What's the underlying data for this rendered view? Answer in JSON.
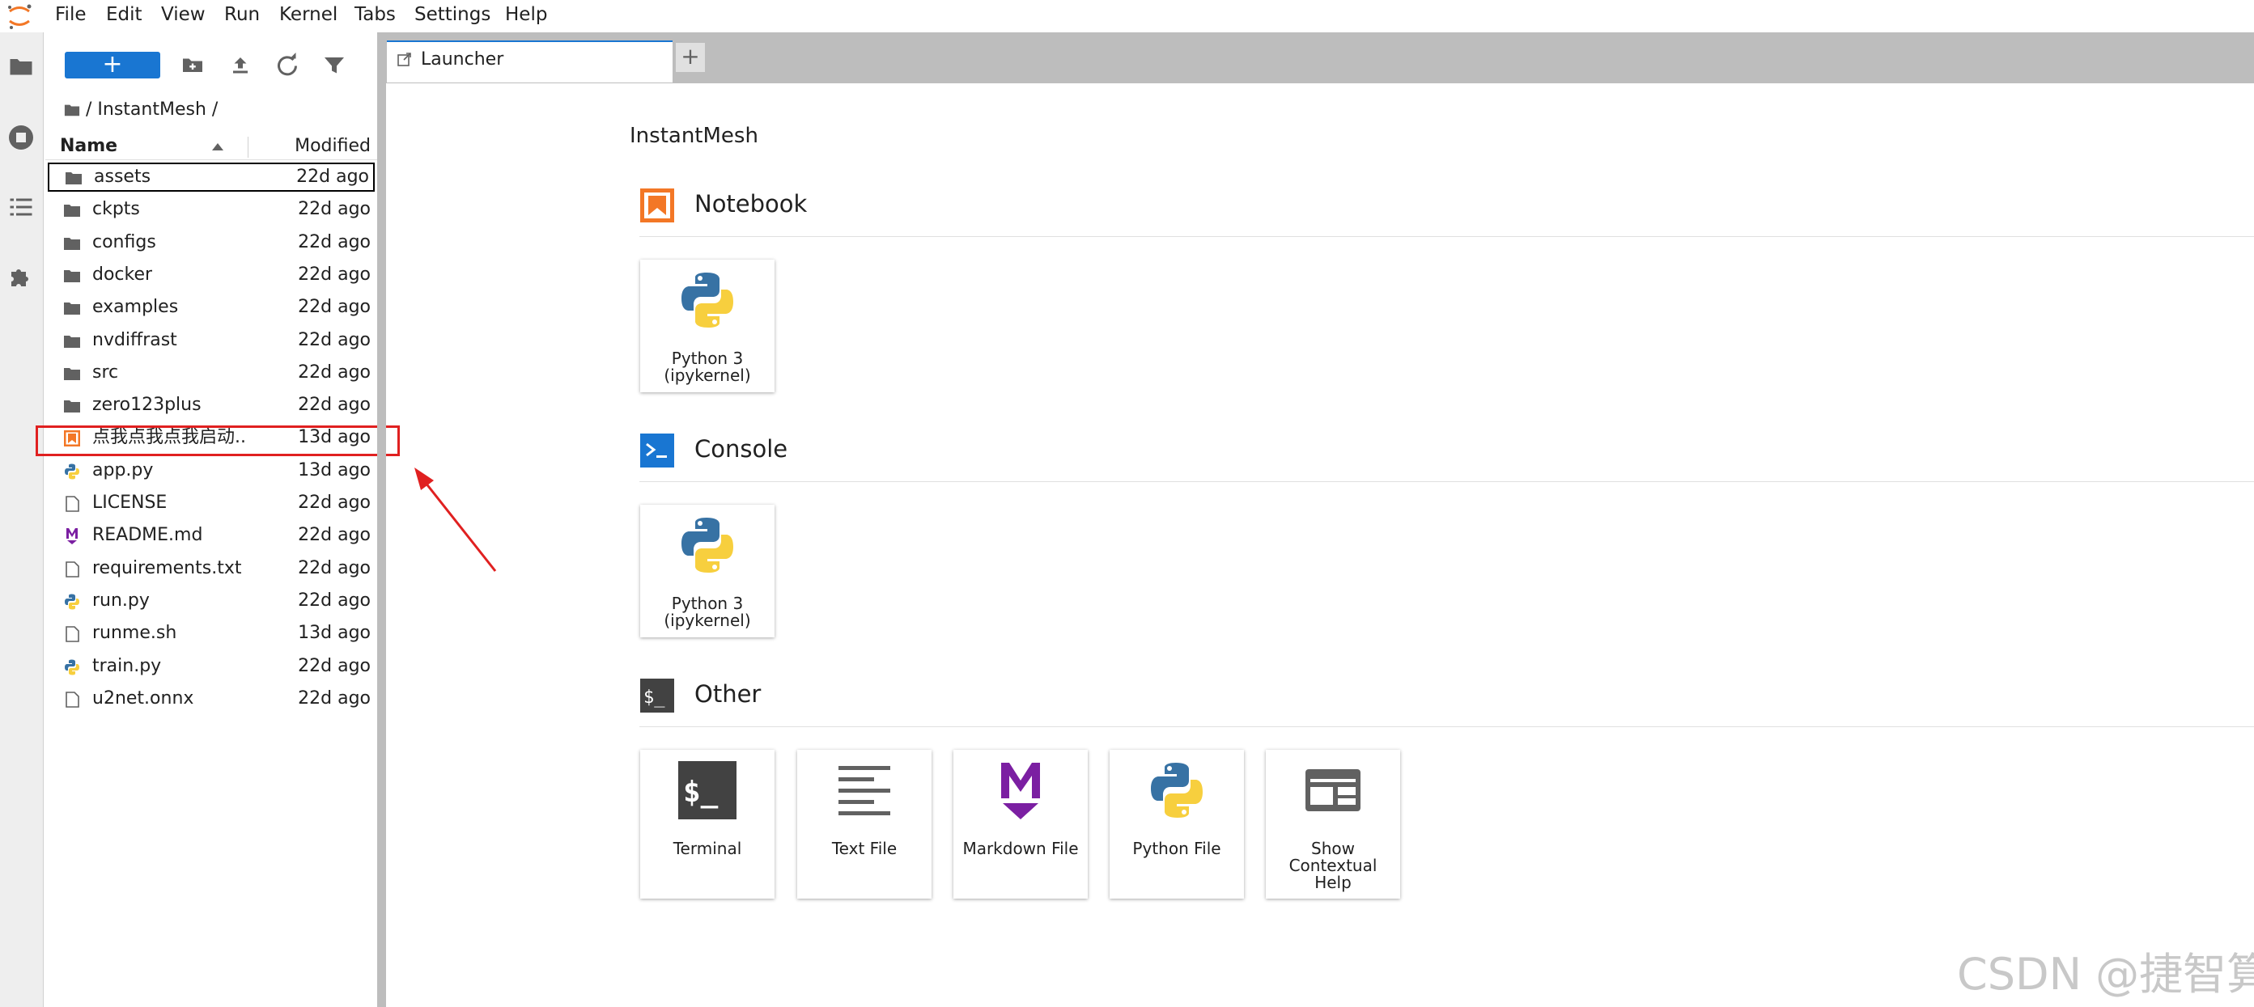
{
  "menu": [
    "File",
    "Edit",
    "View",
    "Run",
    "Kernel",
    "Tabs",
    "Settings",
    "Help"
  ],
  "toolbar": {
    "new_label": "+"
  },
  "breadcrumb": {
    "path": "/ InstantMesh /"
  },
  "file_list": {
    "header_name": "Name",
    "header_modified": "Modified",
    "files": [
      {
        "name": "assets",
        "modified": "22d ago",
        "icon": "folder-icon"
      },
      {
        "name": "ckpts",
        "modified": "22d ago",
        "icon": "folder-icon"
      },
      {
        "name": "configs",
        "modified": "22d ago",
        "icon": "folder-icon"
      },
      {
        "name": "docker",
        "modified": "22d ago",
        "icon": "folder-icon"
      },
      {
        "name": "examples",
        "modified": "22d ago",
        "icon": "folder-icon"
      },
      {
        "name": "nvdiffrast",
        "modified": "22d ago",
        "icon": "folder-icon"
      },
      {
        "name": "src",
        "modified": "22d ago",
        "icon": "folder-icon"
      },
      {
        "name": "zero123plus",
        "modified": "22d ago",
        "icon": "folder-icon"
      },
      {
        "name": "点我点我点我启动...",
        "modified": "13d ago",
        "icon": "notebook-icon"
      },
      {
        "name": "app.py",
        "modified": "13d ago",
        "icon": "python-icon"
      },
      {
        "name": "LICENSE",
        "modified": "22d ago",
        "icon": "file-icon"
      },
      {
        "name": "README.md",
        "modified": "22d ago",
        "icon": "markdown-icon"
      },
      {
        "name": "requirements.txt",
        "modified": "22d ago",
        "icon": "file-icon"
      },
      {
        "name": "run.py",
        "modified": "22d ago",
        "icon": "python-icon"
      },
      {
        "name": "runme.sh",
        "modified": "13d ago",
        "icon": "file-icon"
      },
      {
        "name": "train.py",
        "modified": "22d ago",
        "icon": "python-icon"
      },
      {
        "name": "u2net.onnx",
        "modified": "22d ago",
        "icon": "file-icon"
      }
    ]
  },
  "tabs": {
    "launcher_label": "Launcher",
    "add_label": "+"
  },
  "launcher": {
    "title": "InstantMesh",
    "notebook": {
      "title": "Notebook",
      "card_label_1": "Python 3",
      "card_label_2": "(ipykernel)"
    },
    "console": {
      "title": "Console",
      "card_label_1": "Python 3",
      "card_label_2": "(ipykernel)"
    },
    "other": {
      "title": "Other",
      "terminal": "Terminal",
      "text_file": "Text File",
      "markdown_file": "Markdown File",
      "python_file": "Python File",
      "contextual_1": "Show",
      "contextual_2": "Contextual",
      "contextual_3": "Help"
    }
  },
  "watermark": "CSDN @捷智算",
  "colors": {
    "accent": "#1976d2",
    "highlight": "#e02020",
    "notebook": "#f37726"
  }
}
